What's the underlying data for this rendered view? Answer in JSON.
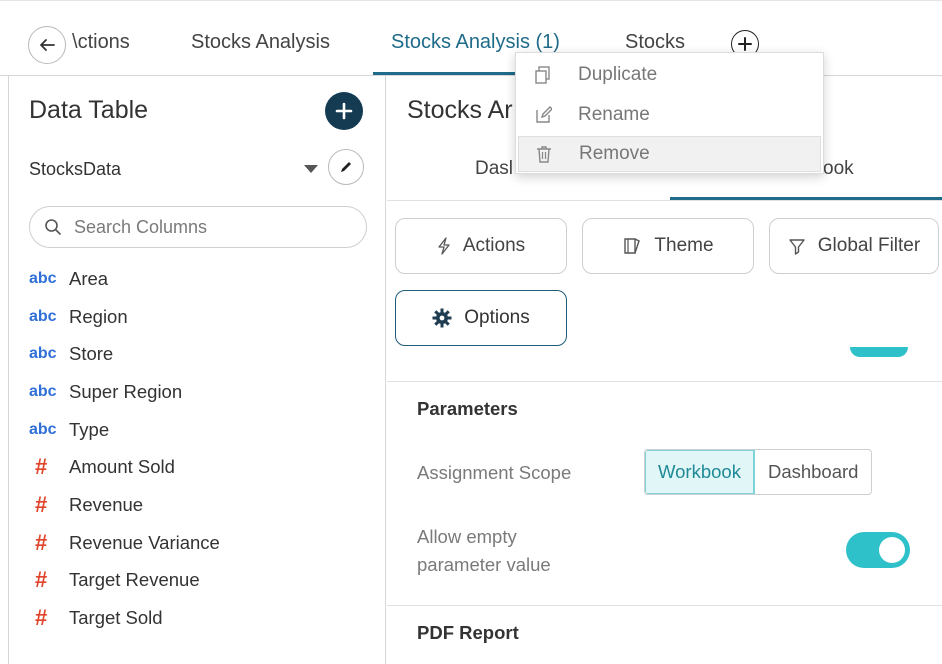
{
  "tabs": {
    "items": [
      {
        "label": "​ctions",
        "display": "\\ctions"
      },
      {
        "label": "Stocks Analysis"
      },
      {
        "label": "Stocks Analysis (1)"
      },
      {
        "label": "Stocks"
      }
    ],
    "active_index": 2
  },
  "context_menu": {
    "items": [
      {
        "label": "Duplicate",
        "icon": "duplicate-icon"
      },
      {
        "label": "Rename",
        "icon": "rename-icon"
      },
      {
        "label": "Remove",
        "icon": "trash-icon"
      }
    ],
    "hovered_index": 2
  },
  "left_panel": {
    "title": "Data Table",
    "data_source": "StocksData",
    "search_placeholder": "Search Columns",
    "columns": [
      {
        "type": "abc",
        "name": "Area"
      },
      {
        "type": "abc",
        "name": "Region"
      },
      {
        "type": "abc",
        "name": "Store"
      },
      {
        "type": "abc",
        "name": "Super Region"
      },
      {
        "type": "abc",
        "name": "Type"
      },
      {
        "type": "#",
        "name": "Amount Sold"
      },
      {
        "type": "#",
        "name": "Revenue"
      },
      {
        "type": "#",
        "name": "Revenue Variance"
      },
      {
        "type": "#",
        "name": "Target Revenue"
      },
      {
        "type": "#",
        "name": "Target Sold"
      }
    ]
  },
  "right_panel": {
    "title": "Stocks Ar",
    "subtabs": [
      "Dasl",
      "ook"
    ],
    "buttons": {
      "actions": "Actions",
      "theme": "Theme",
      "global_filter": "Global Filter",
      "options": "Options"
    },
    "parameters": {
      "heading": "Parameters",
      "assignment_scope_label": "Assignment Scope",
      "scope_options": [
        "Workbook",
        "Dashboard"
      ],
      "scope_selected": "Workbook",
      "allow_empty_label_line1": "Allow empty",
      "allow_empty_label_line2": "parameter value",
      "allow_empty_enabled": true
    },
    "pdf_report_heading": "PDF Report"
  },
  "colors": {
    "accent": "#1f6b8a",
    "toggle_on": "#2fc1c9",
    "add_button": "#153b52",
    "number_type": "#e0452b",
    "text_type": "#2f6fd8"
  }
}
